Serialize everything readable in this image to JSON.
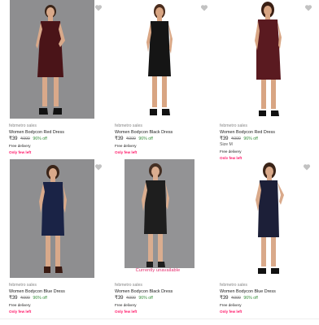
{
  "products": [
    {
      "brand": "febmetro sales",
      "title": "Women Bodycon Red Dress",
      "price": "₹39",
      "mrp": "₹999",
      "discount": "96% off",
      "size": "",
      "delivery": "Free delivery",
      "stock": "Only few left",
      "unavailable": "",
      "dress_color": "#4a1418",
      "background": "grey"
    },
    {
      "brand": "febmetro sales",
      "title": "Women Bodycon Black Dress",
      "price": "₹39",
      "mrp": "₹999",
      "discount": "96% off",
      "size": "",
      "delivery": "Free delivery",
      "stock": "Only few left",
      "unavailable": "",
      "dress_color": "#151515",
      "background": "white"
    },
    {
      "brand": "febmetro sales",
      "title": "Women Bodycon Red Dress",
      "price": "₹39",
      "mrp": "₹999",
      "discount": "96% off",
      "size": "Size M",
      "delivery": "Free delivery",
      "stock": "Only few left",
      "unavailable": "",
      "dress_color": "#5a1a20",
      "background": "white"
    },
    {
      "brand": "febmetro sales",
      "title": "Women Bodycon Blue Dress",
      "price": "₹39",
      "mrp": "₹999",
      "discount": "96% off",
      "size": "",
      "delivery": "Free delivery",
      "stock": "Only few left",
      "unavailable": "",
      "dress_color": "#1a2346",
      "background": "grey"
    },
    {
      "brand": "febmetro sales",
      "title": "Women Bodycon Black Dress",
      "price": "₹39",
      "mrp": "₹999",
      "discount": "96% off",
      "size": "",
      "delivery": "Free delivery",
      "stock": "Only few left",
      "unavailable": "Currently unavailable",
      "dress_color": "#121212",
      "background": "grey"
    },
    {
      "brand": "febmetro sales",
      "title": "Women Bodycon Blue Dress",
      "price": "₹39",
      "mrp": "₹999",
      "discount": "96% off",
      "size": "",
      "delivery": "Free delivery",
      "stock": "Only few left",
      "unavailable": "",
      "dress_color": "#1c1f38",
      "background": "white"
    }
  ],
  "colors": {
    "discount": "#388e3c",
    "stock_warning": "#ff1a6a",
    "unavailable": "#e4286a",
    "heart_outline": "#c2c2c2"
  },
  "icons": {
    "wishlist": "heart-icon"
  }
}
